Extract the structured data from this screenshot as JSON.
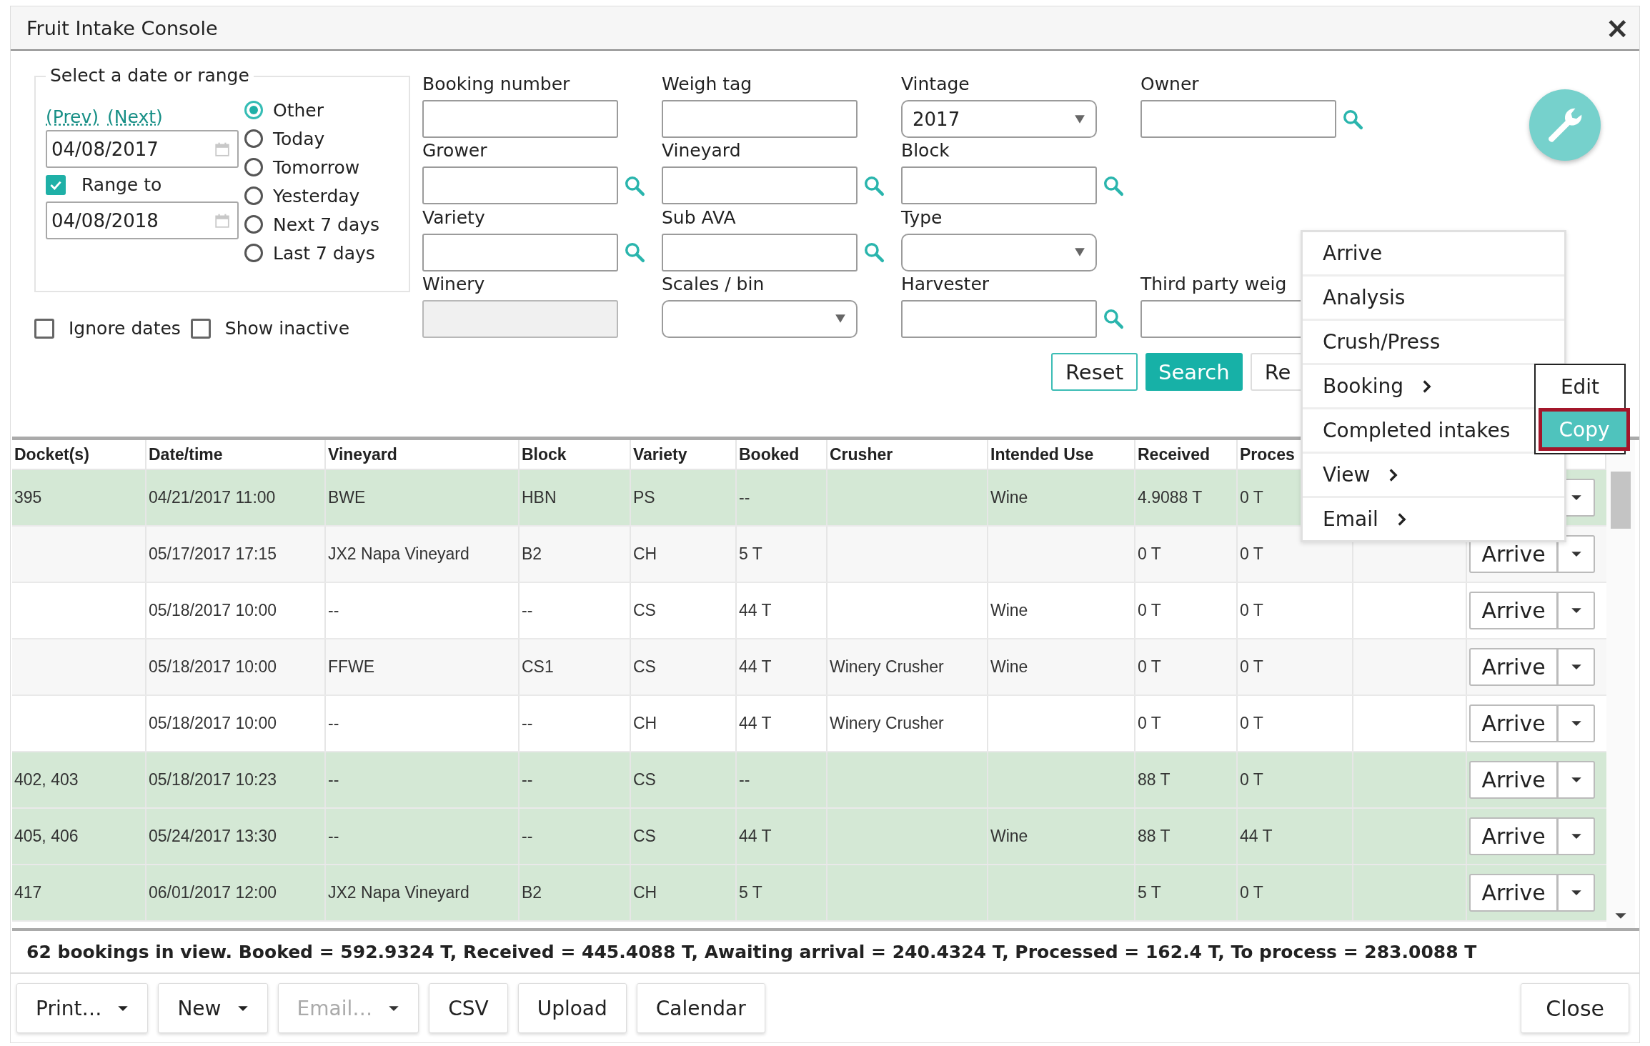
{
  "window": {
    "title": "Fruit Intake Console",
    "close": "×"
  },
  "date_range": {
    "legend": "Select a date or range",
    "links": [
      "(Prev)",
      "(Next)"
    ],
    "from": "04/08/2017",
    "range_to": {
      "label": "Range to",
      "checked": true
    },
    "to": "04/08/2018",
    "options": [
      {
        "label": "Other",
        "selected": true
      },
      {
        "label": "Today",
        "selected": false
      },
      {
        "label": "Tomorrow",
        "selected": false
      },
      {
        "label": "Yesterday",
        "selected": false
      },
      {
        "label": "Next 7 days",
        "selected": false
      },
      {
        "label": "Last 7 days",
        "selected": false
      }
    ]
  },
  "flags": [
    {
      "label": "Ignore dates",
      "checked": false
    },
    {
      "label": "Show inactive",
      "checked": false
    }
  ],
  "field_columns": [
    [
      {
        "label": "Booking number",
        "kind": "text",
        "lookup": false
      },
      {
        "label": "Grower",
        "kind": "text",
        "lookup": true
      },
      {
        "label": "Variety",
        "kind": "text",
        "lookup": true
      },
      {
        "label": "Winery",
        "kind": "disabled",
        "lookup": false
      }
    ],
    [
      {
        "label": "Weigh tag",
        "kind": "text",
        "lookup": false
      },
      {
        "label": "Vineyard",
        "kind": "text",
        "lookup": true
      },
      {
        "label": "Sub AVA",
        "kind": "text",
        "lookup": true
      },
      {
        "label": "Scales / bin",
        "kind": "select",
        "lookup": false
      }
    ],
    [
      {
        "label": "Vintage",
        "kind": "select",
        "value": "2017",
        "lookup": false
      },
      {
        "label": "Block",
        "kind": "text",
        "lookup": true
      },
      {
        "label": "Type",
        "kind": "select",
        "lookup": false
      },
      {
        "label": "Harvester",
        "kind": "text",
        "lookup": true
      }
    ],
    [
      {
        "label": "Owner",
        "kind": "text",
        "lookup": true
      },
      {
        "label": "Third party weig",
        "kind": "text"
      }
    ]
  ],
  "actions": [
    {
      "label": "Reset",
      "kind": "outline"
    },
    {
      "label": "Search",
      "kind": "primary"
    },
    {
      "label": "Re",
      "kind": "outline"
    }
  ],
  "table": {
    "columns": [
      "Docket(s)",
      "Date/time",
      "Vineyard",
      "Block",
      "Variety",
      "Booked",
      "Crusher",
      "Intended Use",
      "Received",
      "Proces"
    ],
    "rows": [
      {
        "highlighted": true,
        "cells": [
          "395",
          "04/21/2017 11:00",
          "BWE",
          "HBN",
          "PS",
          "--",
          "",
          "Wine",
          "4.9088 T",
          "0 T"
        ]
      },
      {
        "highlighted": false,
        "cells": [
          "",
          "05/17/2017 17:15",
          "JX2 Napa Vineyard",
          "B2",
          "CH",
          "5 T",
          "",
          "",
          "0 T",
          "0 T"
        ],
        "action": "Arrive"
      },
      {
        "highlighted": false,
        "cells": [
          "",
          "05/18/2017 10:00",
          "--",
          "--",
          "CS",
          "44 T",
          "",
          "Wine",
          "0 T",
          "0 T"
        ],
        "action": "Arrive"
      },
      {
        "highlighted": false,
        "cells": [
          "",
          "05/18/2017 10:00",
          "FFWE",
          "CS1",
          "CS",
          "44 T",
          "Winery Crusher",
          "Wine",
          "0 T",
          "0 T"
        ],
        "action": "Arrive"
      },
      {
        "highlighted": false,
        "cells": [
          "",
          "05/18/2017 10:00",
          "--",
          "--",
          "CH",
          "44 T",
          "Winery Crusher",
          "",
          "0 T",
          "0 T"
        ],
        "action": "Arrive"
      },
      {
        "highlighted": true,
        "cells": [
          "402, 403",
          "05/18/2017 10:23",
          "--",
          "--",
          "CS",
          "--",
          "",
          "",
          "88 T",
          "0 T"
        ],
        "action": "Arrive"
      },
      {
        "highlighted": true,
        "cells": [
          "405, 406",
          "05/24/2017 13:30",
          "--",
          "--",
          "CS",
          "44 T",
          "",
          "Wine",
          "88 T",
          "44 T"
        ],
        "action": "Arrive"
      },
      {
        "highlighted": true,
        "cells": [
          "417",
          "06/01/2017 12:00",
          "JX2 Napa Vineyard",
          "B2",
          "CH",
          "5 T",
          "",
          "",
          "5 T",
          "0 T"
        ],
        "action": "Arrive"
      }
    ]
  },
  "context_menu": {
    "items": [
      {
        "label": "Arrive",
        "submenu": false
      },
      {
        "label": "Analysis",
        "submenu": false
      },
      {
        "label": "Crush/Press",
        "submenu": false
      },
      {
        "label": "Booking",
        "submenu": true
      },
      {
        "label": "Completed intakes",
        "submenu": false
      },
      {
        "label": "View",
        "submenu": true
      },
      {
        "label": "Email",
        "submenu": true
      }
    ]
  },
  "submenu": {
    "items": [
      {
        "label": "Edit",
        "selected": false
      },
      {
        "label": "Copy",
        "selected": true
      }
    ]
  },
  "summary": "62 bookings in view. Booked = 592.9324 T, Received = 445.4088 T, Awaiting arrival = 240.4324 T, Processed = 162.4 T, To process = 283.0088 T",
  "footer_buttons": [
    {
      "label": "Print…",
      "kind": "dropdown",
      "disabled": false
    },
    {
      "label": "New",
      "kind": "dropdown",
      "disabled": false
    },
    {
      "label": "Email…",
      "kind": "dropdown",
      "disabled": true
    },
    {
      "label": "CSV",
      "kind": "plain",
      "disabled": false
    },
    {
      "label": "Upload",
      "kind": "plain",
      "disabled": false
    },
    {
      "label": "Calendar",
      "kind": "plain",
      "disabled": false
    }
  ],
  "close_button": "Close"
}
